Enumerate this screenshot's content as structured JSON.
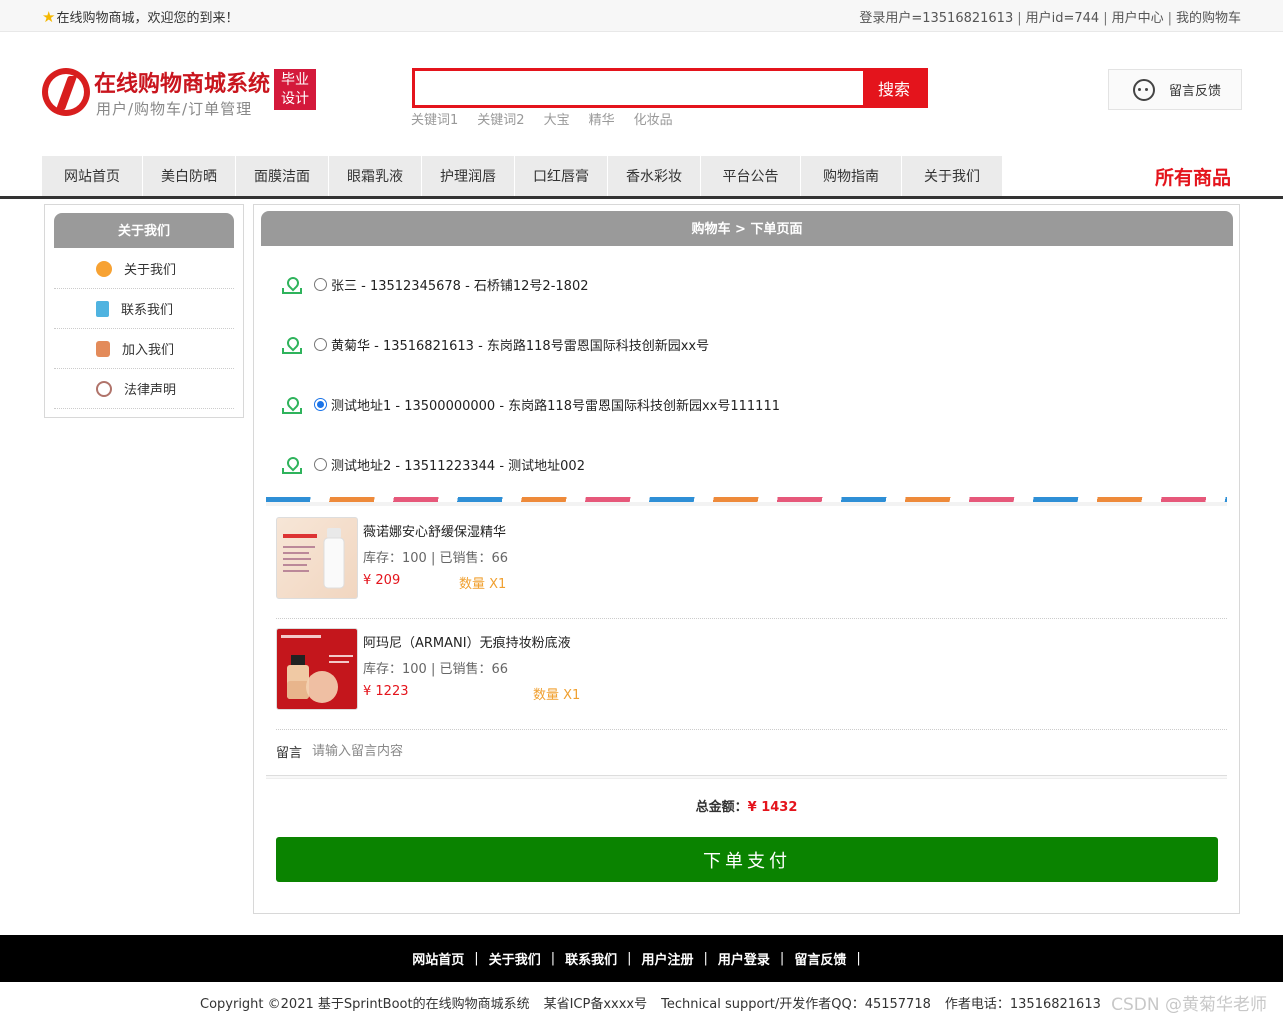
{
  "topbar": {
    "welcome": "在线购物商城，欢迎您的到来！",
    "user_info": "登录用户=13516821613",
    "user_id": "用户id=744",
    "user_center": "用户中心",
    "my_cart": "我的购物车"
  },
  "header": {
    "logo_title": "在线购物商城系统",
    "logo_subtitle": "用户/购物车/订单管理",
    "badge_line1": "毕业",
    "badge_line2": "设计",
    "search_placeholder": "",
    "search_button": "搜索",
    "keywords": [
      "关键词1",
      "关键词2",
      "大宝",
      "精华",
      "化妆品"
    ],
    "feedback": "留言反馈"
  },
  "nav": {
    "items": [
      "网站首页",
      "美白防晒",
      "面膜洁面",
      "眼霜乳液",
      "护理润唇",
      "口红唇膏",
      "香水彩妆",
      "平台公告",
      "购物指南",
      "关于我们"
    ],
    "all_goods": "所有商品"
  },
  "sidebar": {
    "title": "关于我们",
    "links": [
      "关于我们",
      "联系我们",
      "加入我们",
      "法律声明"
    ]
  },
  "panel": {
    "title": "购物车 > 下单页面",
    "addresses": [
      {
        "text": "张三 - 13512345678 - 石桥铺12号2-1802",
        "checked": false
      },
      {
        "text": "黄菊华 - 13516821613 - 东岗路118号雷恩国际科技创新园xx号",
        "checked": false
      },
      {
        "text": "测试地址1 - 13500000000 - 东岗路118号雷恩国际科技创新园xx号111111",
        "checked": true
      },
      {
        "text": "测试地址2 - 13511223344 - 测试地址002",
        "checked": false
      }
    ],
    "products": [
      {
        "name": "薇诺娜安心舒缓保湿精华",
        "stock": "库存：100 | 已销售：66",
        "price": "¥ 209",
        "qty": "数量 X1",
        "img_brand": "WINONA 薇诺娜"
      },
      {
        "name": "阿玛尼（ARMANI）无痕持妆粉底液",
        "stock": "库存：100 | 已销售：66",
        "price": "¥ 1223",
        "qty": "数量 X1",
        "img_brand": "GIORGIO ARMANI"
      }
    ],
    "message_label": "留言",
    "message_placeholder": "请输入留言内容",
    "total_label": "总金额：",
    "total_amount": "¥ 1432",
    "pay_button": "下单支付"
  },
  "footer": {
    "links": [
      "网站首页",
      "关于我们",
      "联系我们",
      "用户注册",
      "用户登录",
      "留言反馈"
    ],
    "copyright": "Copyright ©2021 基于SprintBoot的在线购物商城系统",
    "icp": "某省ICP备xxxx号",
    "support": "Technical support/开发作者QQ：45157718",
    "phone": "作者电话：13516821613",
    "watermark": "CSDN @黄菊华老师"
  },
  "colors": {
    "accent": "#e4141c",
    "pay": "#0a8300",
    "panel_head": "#9a9a9a"
  }
}
